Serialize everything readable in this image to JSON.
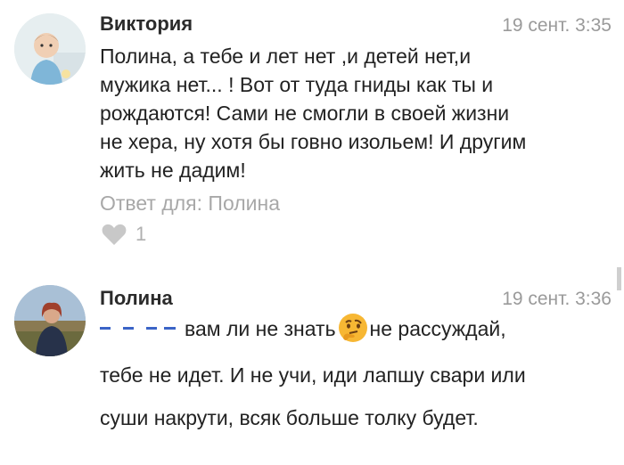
{
  "comments": [
    {
      "author": "Виктория",
      "date": "19 сент. 3:35",
      "text": "Полина, а тебе и лет нет ,и детей нет,и\nмужика нет... ! Вот от туда гниды как ты и\nрождаются! Сами не смогли в своей жизни\nне хера, ну хотя бы говно изольем! И другим\nжить не дадим!",
      "reply_to": "Ответ для: Полина",
      "likes": "1",
      "avatar_icon": "child-photo-avatar"
    },
    {
      "author": "Полина",
      "date": "19 сент. 3:36",
      "line1_a": "вам ли не знать",
      "line1_b": "не рассуждай,",
      "line2": "тебе не идет. И не учи, иди лапшу свари или",
      "line3": "суши накрути, всяк больше толку будет.",
      "emoji": "thinking-face-emoji",
      "avatar_icon": "woman-photo-avatar"
    }
  ],
  "colors": {
    "text": "#222222",
    "muted": "#9a9a9a",
    "mention": "#3b64c7"
  }
}
